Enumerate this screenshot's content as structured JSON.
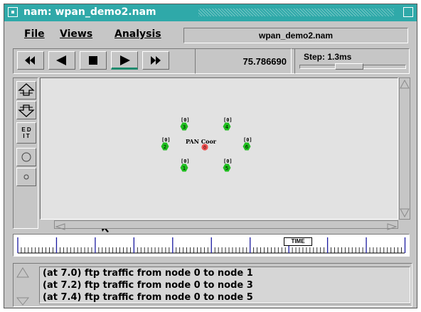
{
  "window": {
    "title": "nam: wpan_demo2.nam"
  },
  "menu": {
    "file": "File",
    "views": "Views",
    "analysis": "Analysis",
    "filename": "wpan_demo2.nam"
  },
  "controls": {
    "time": "75.786690",
    "step_label": "Step: 1.3ms",
    "buttons": [
      "rewind-icon",
      "play-backward-icon",
      "stop-icon",
      "play-forward-icon",
      "fast-forward-icon"
    ]
  },
  "tools": {
    "edit_top": "E D",
    "edit_bottom": "I T"
  },
  "canvas": {
    "coordinator_label": "PAN Coor",
    "nodes": [
      {
        "id": "0",
        "queue": "",
        "color": "#f05050"
      },
      {
        "id": "1",
        "queue": "[0]",
        "color": "#1fbf1f"
      },
      {
        "id": "2",
        "queue": "[0]",
        "color": "#1fbf1f"
      },
      {
        "id": "3",
        "queue": "[0]",
        "color": "#1fbf1f"
      },
      {
        "id": "4",
        "queue": "[0]",
        "color": "#1fbf1f"
      },
      {
        "id": "5",
        "queue": "[0]",
        "color": "#1fbf1f"
      },
      {
        "id": "6",
        "queue": "[0]",
        "color": "#1fbf1f"
      }
    ]
  },
  "timeline": {
    "label": "TIME"
  },
  "log": {
    "lines": [
      "(at 7.0) ftp traffic from node 0 to node 1",
      "(at 7.2) ftp traffic from node 0 to node 3",
      "(at 7.4) ftp traffic from node 0 to node 5"
    ]
  }
}
